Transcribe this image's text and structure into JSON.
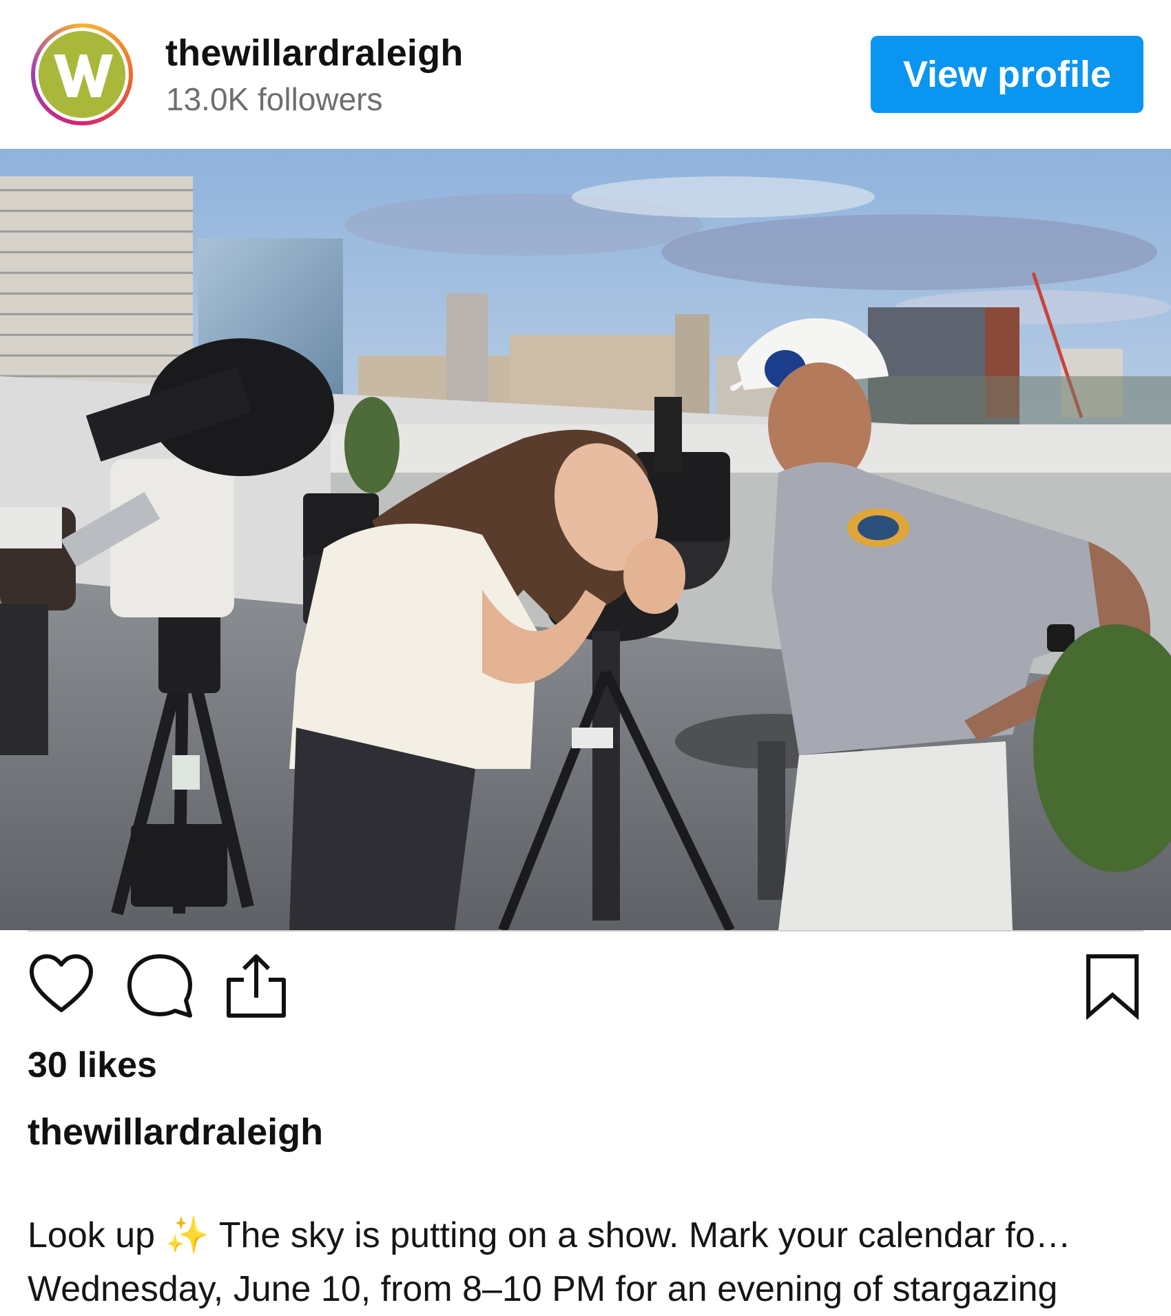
{
  "profile": {
    "username": "thewillardraleigh",
    "followers": "13.0K followers",
    "view_profile_label": "View profile",
    "avatar_icon": "willard-w-logo",
    "accent_color": "#0a95f0"
  },
  "post": {
    "image_icon": "rooftop-stargazing-photo",
    "likes": "30 likes",
    "caption_username": "thewillardraleigh",
    "caption_line1": "Look up ✨ The sky is putting on a show. Mark your calendar fo…",
    "caption_line2": "Wednesday, June 10, from 8–10 PM for an evening of stargazing"
  },
  "actions": {
    "like_icon": "heart-icon",
    "comment_icon": "comment-icon",
    "share_icon": "share-icon",
    "save_icon": "bookmark-icon"
  }
}
